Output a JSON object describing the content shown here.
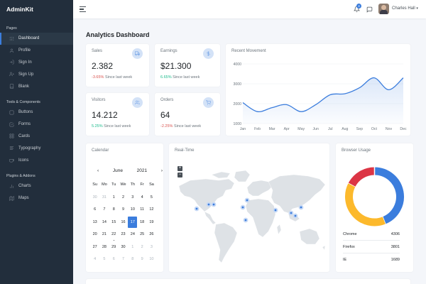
{
  "brand": "AdminKit",
  "sidebar": {
    "sections": [
      {
        "header": "Pages",
        "items": [
          {
            "label": "Dashboard",
            "icon": "sliders-icon",
            "active": true
          },
          {
            "label": "Profile",
            "icon": "user-icon"
          },
          {
            "label": "Sign In",
            "icon": "log-in-icon"
          },
          {
            "label": "Sign Up",
            "icon": "user-plus-icon"
          },
          {
            "label": "Blank",
            "icon": "book-icon"
          }
        ]
      },
      {
        "header": "Tools & Components",
        "items": [
          {
            "label": "Buttons",
            "icon": "square-icon"
          },
          {
            "label": "Forms",
            "icon": "check-square-icon"
          },
          {
            "label": "Cards",
            "icon": "grid-icon"
          },
          {
            "label": "Typography",
            "icon": "align-left-icon"
          },
          {
            "label": "Icons",
            "icon": "coffee-icon"
          }
        ]
      },
      {
        "header": "Plugins & Addons",
        "items": [
          {
            "label": "Charts",
            "icon": "bar-chart-icon"
          },
          {
            "label": "Maps",
            "icon": "map-icon"
          }
        ]
      }
    ]
  },
  "topbar": {
    "notification_count": "4",
    "user_name": "Charles Hall"
  },
  "page_title": {
    "bold": "Analytics",
    "rest": " Dashboard"
  },
  "stats": {
    "sales": {
      "title": "Sales",
      "value": "2.382",
      "delta": "-3.65%",
      "delta_dir": "down",
      "suffix": " Since last week",
      "icon": "truck-icon"
    },
    "earnings": {
      "title": "Earnings",
      "value": "$21.300",
      "delta": "6.65%",
      "delta_dir": "up",
      "suffix": " Since last week",
      "icon": "dollar-sign-icon"
    },
    "visitors": {
      "title": "Visitors",
      "value": "14.212",
      "delta": "5.25%",
      "delta_dir": "up",
      "suffix": " Since last week",
      "icon": "users-icon"
    },
    "orders": {
      "title": "Orders",
      "value": "64",
      "delta": "-2.25%",
      "delta_dir": "down",
      "suffix": " Since last week",
      "icon": "shopping-cart-icon"
    }
  },
  "movement": {
    "title": "Recent Movement",
    "chart_data": {
      "type": "area",
      "categories": [
        "Jan",
        "Feb",
        "Mar",
        "Apr",
        "May",
        "Jun",
        "Jul",
        "Aug",
        "Sep",
        "Oct",
        "Nov",
        "Dec"
      ],
      "values": [
        2050,
        1600,
        1800,
        1950,
        1600,
        1950,
        2450,
        2500,
        2800,
        3300,
        2700,
        3300
      ],
      "ylim": [
        1000,
        4000
      ],
      "yticks": [
        "1000",
        "2000",
        "3000",
        "4000"
      ],
      "accent": "#3b7ddd"
    }
  },
  "calendar": {
    "title": "Calendar",
    "month": "June",
    "year": "2021",
    "weekdays": [
      "Su",
      "Mo",
      "Tu",
      "We",
      "Th",
      "Fr",
      "Sa"
    ],
    "weeks": [
      [
        "30",
        "31",
        "1",
        "2",
        "3",
        "4",
        "5"
      ],
      [
        "6",
        "7",
        "8",
        "9",
        "10",
        "11",
        "12"
      ],
      [
        "13",
        "14",
        "15",
        "16",
        "17",
        "18",
        "19"
      ],
      [
        "20",
        "21",
        "22",
        "23",
        "24",
        "25",
        "26"
      ],
      [
        "27",
        "28",
        "29",
        "30",
        "1",
        "2",
        "3"
      ],
      [
        "4",
        "5",
        "6",
        "7",
        "8",
        "9",
        "10"
      ]
    ],
    "selected": "17"
  },
  "realtime": {
    "title": "Real-Time",
    "zoom_in": "+",
    "zoom_out": "−"
  },
  "browser": {
    "title": "Browser Usage",
    "chart_data": {
      "type": "pie",
      "labels": [
        "Chrome",
        "Firefox",
        "IE"
      ],
      "values": [
        4306,
        3801,
        1689
      ],
      "colors": [
        "#3b7ddd",
        "#fcb92c",
        "#dc3545"
      ]
    }
  }
}
